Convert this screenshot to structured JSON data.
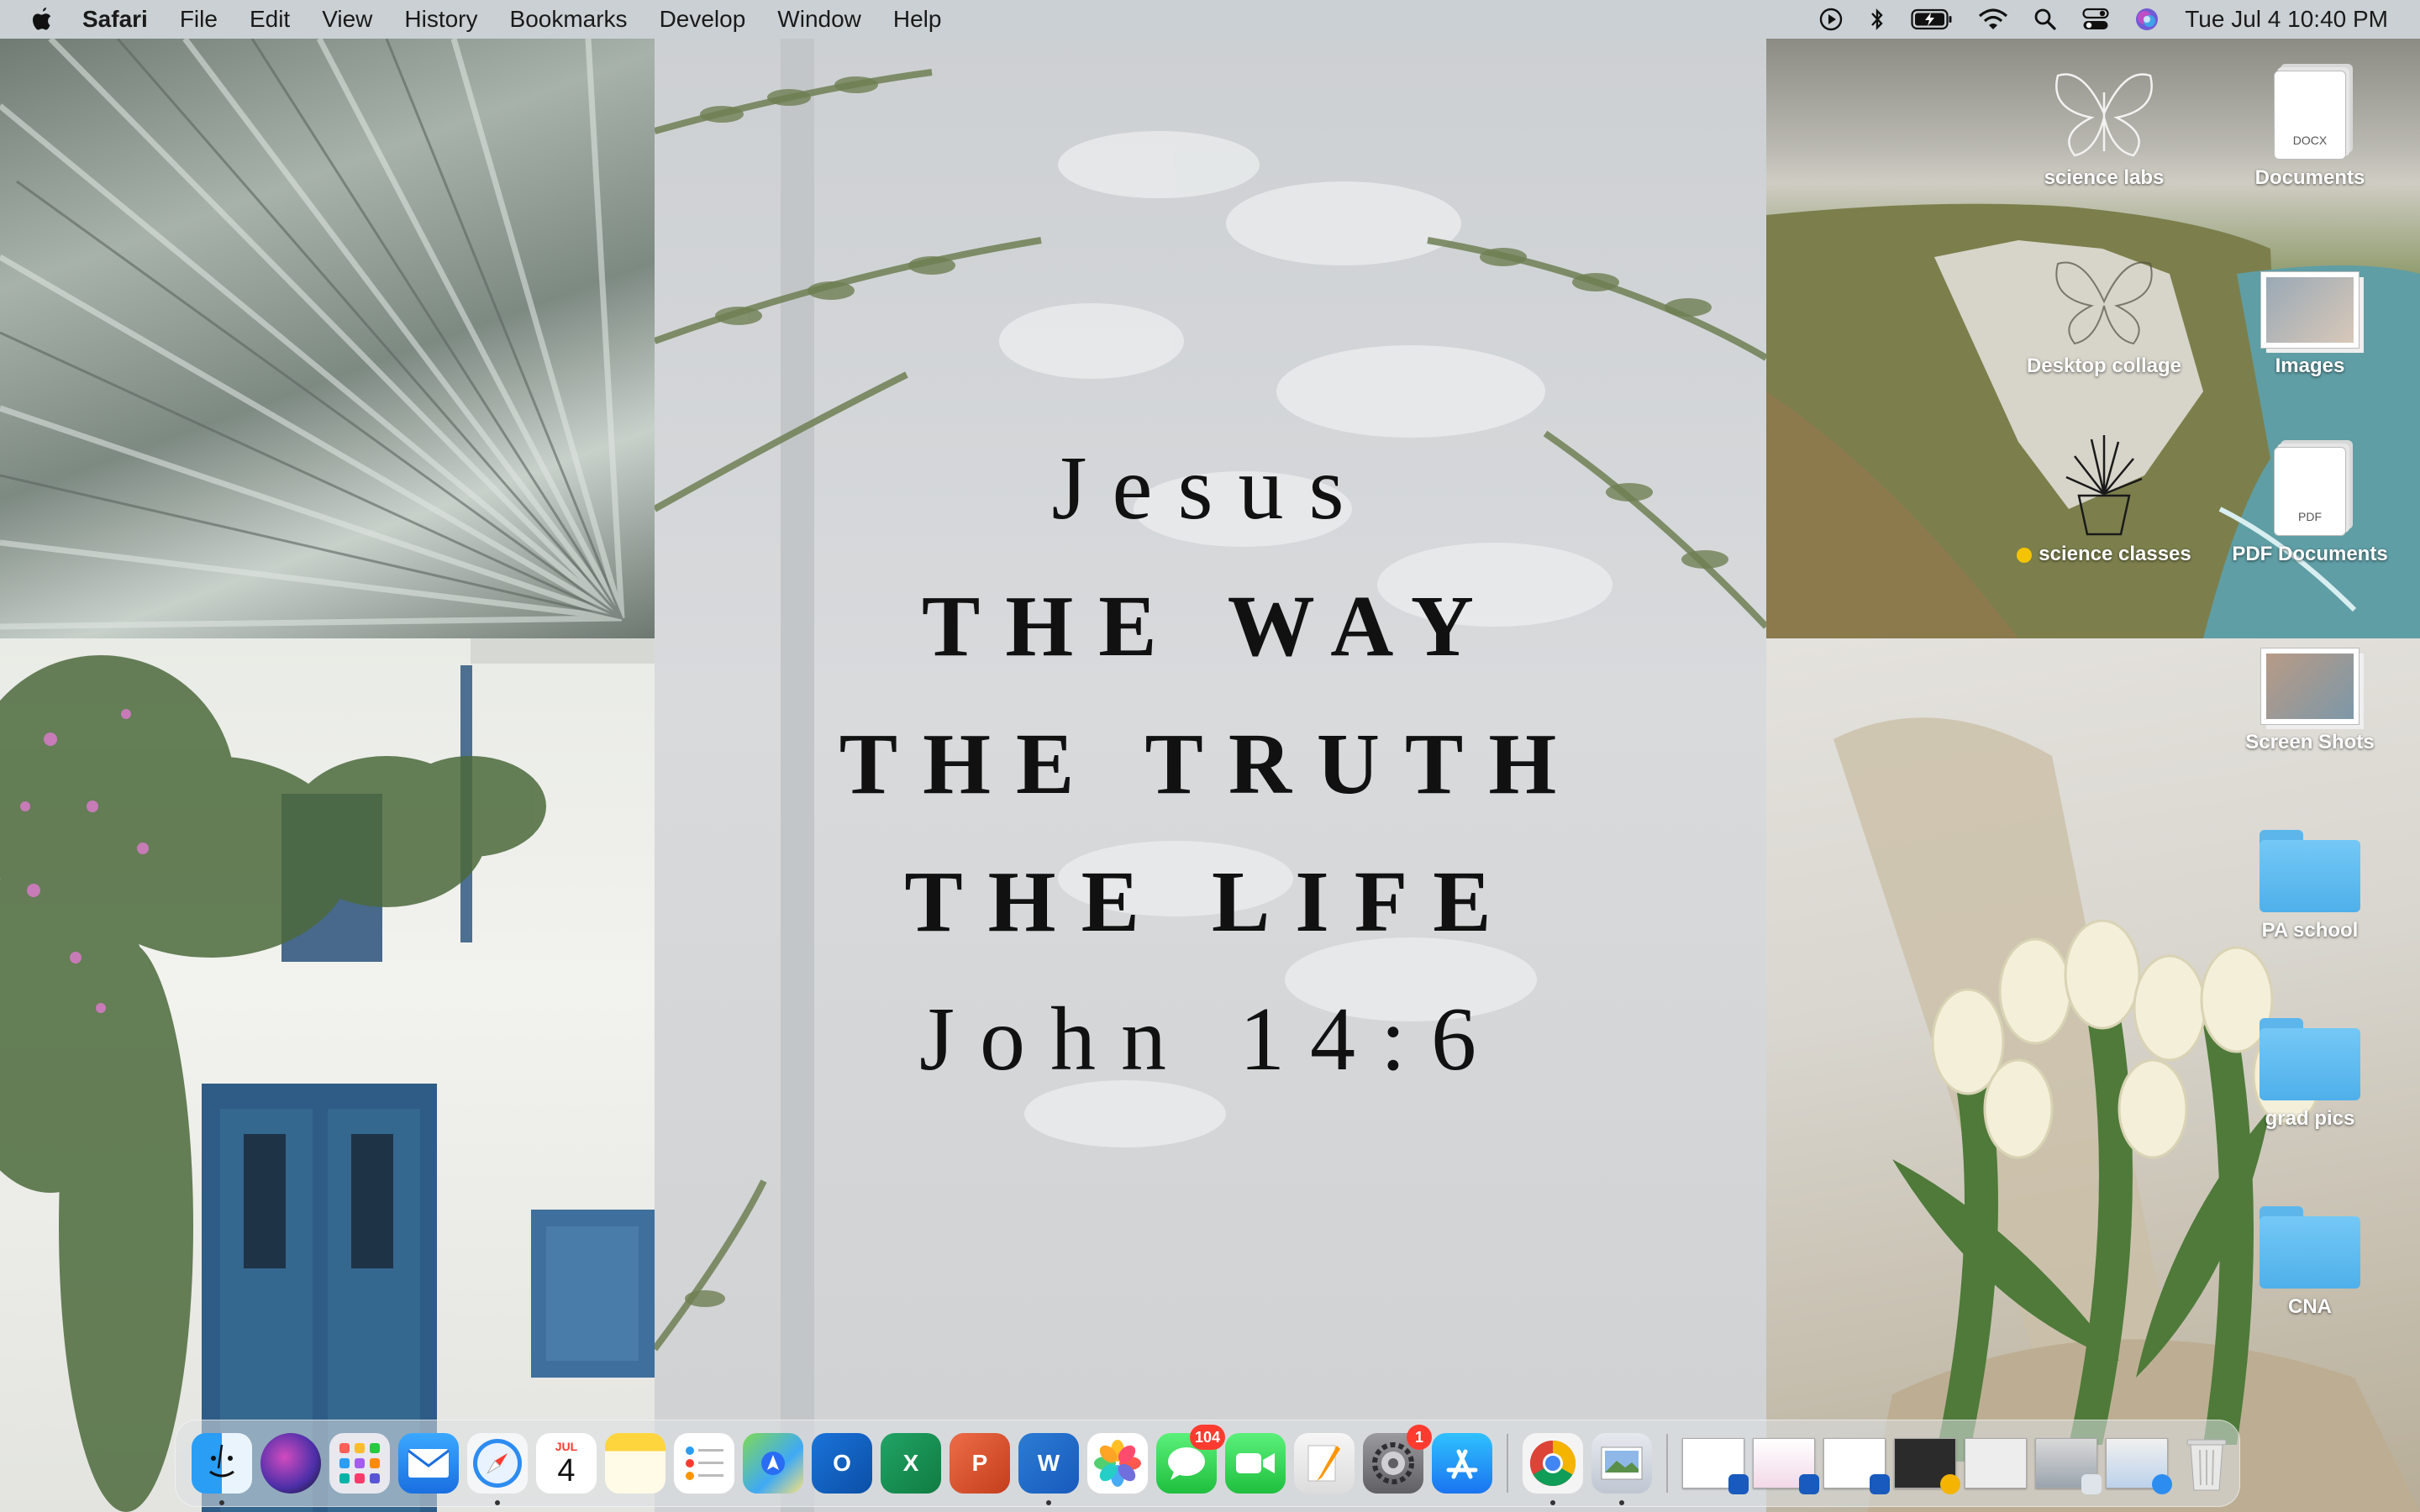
{
  "menubar": {
    "app_name": "Safari",
    "menus": [
      "File",
      "Edit",
      "View",
      "History",
      "Bookmarks",
      "Develop",
      "Window",
      "Help"
    ],
    "clock": "Tue Jul 4  10:40 PM"
  },
  "wallpaper": {
    "verse": {
      "line1": "Jesus",
      "line2": "THE WAY",
      "line3": "THE TRUTH",
      "line4": "THE LIFE",
      "reference": "John 14:6"
    }
  },
  "desktop_icons": [
    {
      "label": "science labs"
    },
    {
      "label": "Documents",
      "tag": "DOCX"
    },
    {
      "label": "Desktop collage"
    },
    {
      "label": "Images"
    },
    {
      "label": "science classes"
    },
    {
      "label": "PDF Documents",
      "tag": "PDF"
    },
    {
      "label": "Screen Shots"
    },
    {
      "label": "PA school"
    },
    {
      "label": "grad pics"
    },
    {
      "label": "CNA"
    }
  ],
  "dock": {
    "calendar": {
      "month": "JUL",
      "day": "4"
    },
    "badges": {
      "messages": "104",
      "system_settings": "1"
    }
  },
  "colors": {
    "menubar_bg": "#ced4d8",
    "folder_blue": "#5cb6ec",
    "badge_red": "#ff3b30"
  }
}
